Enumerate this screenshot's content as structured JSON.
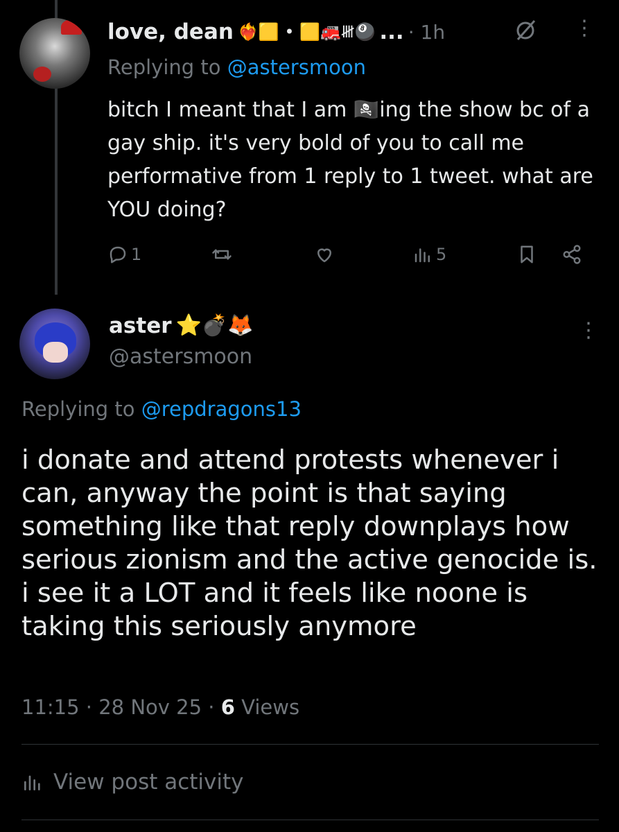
{
  "parent_tweet": {
    "display_name": "love, dean",
    "name_emojis": "❤️‍🔥🟨 • 🟨🚒𝍸🎱",
    "name_ellipsis": "...",
    "time": "· 1h",
    "replying_to_label": "Replying to",
    "replying_to_handle": "@astersmoon",
    "text": "bitch I meant that I am 🏴‍☠️ing the show bc of a gay ship. it's very bold of you to call me performative from 1 reply to 1 tweet. what are YOU doing?",
    "actions": {
      "reply_count": "1",
      "retweet_count": "",
      "like_count": "",
      "views_count": "5"
    }
  },
  "main_tweet": {
    "display_name": "aster",
    "name_emojis": "⭐💣🦊",
    "handle": "@astersmoon",
    "replying_to_label": "Replying to",
    "replying_to_handle": "@repdragons13",
    "text": "i donate and attend protests whenever i can, anyway the point is that saying something like that reply downplays how serious zionism and the active genocide is. i see it a LOT and it feels like noone is taking this seriously anymore",
    "timestamp": "11:15 · 28 Nov 25 · ",
    "views_number": "6",
    "views_label": " Views"
  },
  "view_activity_label": "View post activity",
  "colors": {
    "accent": "#1d9bf0",
    "muted": "#71767b",
    "text": "#e7e9ea",
    "bg": "#000000"
  }
}
